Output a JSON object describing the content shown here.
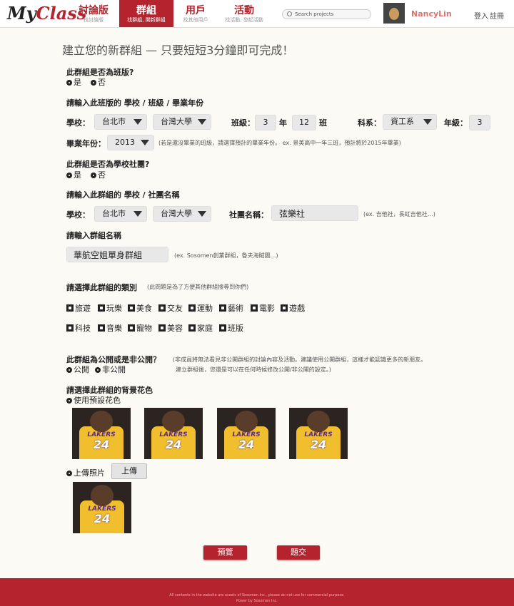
{
  "brand": {
    "logo_a": "My",
    "logo_b": "Class"
  },
  "nav": {
    "items": [
      {
        "title": "討論版",
        "sub": "找討論版"
      },
      {
        "title": "群組",
        "sub": "找群組, 開新群組"
      },
      {
        "title": "用戶",
        "sub": "找其他用戶"
      },
      {
        "title": "活動",
        "sub": "找活動, 發起活動"
      }
    ],
    "search_placeholder": "Search projects",
    "username": "NancyLin",
    "login": "登入",
    "register": "註冊"
  },
  "page_title": "建立您的新群組 — 只要短短3分鐘即可完成！",
  "q_class": {
    "label": "此群組是否為班版?",
    "yes": "是",
    "no": "否"
  },
  "class_info": {
    "label": "請輸入此班版的 學校 / 班級 / 畢業年份",
    "school_label": "學校：",
    "city": "台北市",
    "school": "台灣大學",
    "class_label": "班級：",
    "year_num": "3",
    "year_unit": "年",
    "class_num": "12",
    "class_unit": "班",
    "dept_label": "科系：",
    "dept": "資工系",
    "grade_label": "年級：",
    "grade": "3",
    "grad_label": "畢業年份：",
    "grad_year": "2013",
    "grad_note": "(若是還沒畢業的班級，請選擇預計的畢業年份。 ex. 景美高中一年三班，預計將於2015年畢業)"
  },
  "q_club": {
    "label": "此群組是否為學校社團?",
    "yes": "是",
    "no": "否"
  },
  "club_info": {
    "label": "請輸入此群組的 學校 / 社團名稱",
    "school_label": "學校：",
    "city": "台北市",
    "school": "台灣大學",
    "club_label": "社團名稱：",
    "club_name": "弦樂社",
    "club_note": "(ex. 吉他社，長虹吉他社…)"
  },
  "group_name": {
    "label": "請輸入群組名稱",
    "value": "華航空姐單身群組",
    "note": "(ex. Sosomen創業群組，魯夫海賊團…)"
  },
  "category": {
    "label": "請選擇此群組的類別",
    "note": "(此問題是為了方便其他群組搜尋到你們)",
    "row1": [
      "旅遊",
      "玩樂",
      "美食",
      "交友",
      "運動",
      "藝術",
      "電影",
      "遊戲"
    ],
    "row2": [
      "科技",
      "音樂",
      "寵物",
      "美容",
      "家庭",
      "班版"
    ]
  },
  "visibility": {
    "label": "此群組為公開或是非公開？",
    "note1": "(非成員將無法看見非公開群組的討論內容及活動。建議使用公開群組，這樣才能認識更多的新朋友。",
    "note2": "建立群組後，您還是可以在任何時候修改公開/非公開的設定。)",
    "public": "公開",
    "private": "非公開"
  },
  "background": {
    "label": "請選擇此群組的背景花色",
    "default_option": "使用預設花色",
    "upload_option": "上傳照片",
    "upload_button": "上傳",
    "photo_text": "LAKERS",
    "photo_number": "24"
  },
  "actions": {
    "preview": "預覽",
    "submit": "題交"
  },
  "footer": {
    "line1": "All contents in the website are assets of Sosomen Inc., please do not use for commercial purpose.",
    "line2": "Power by Sosomen Inc."
  }
}
